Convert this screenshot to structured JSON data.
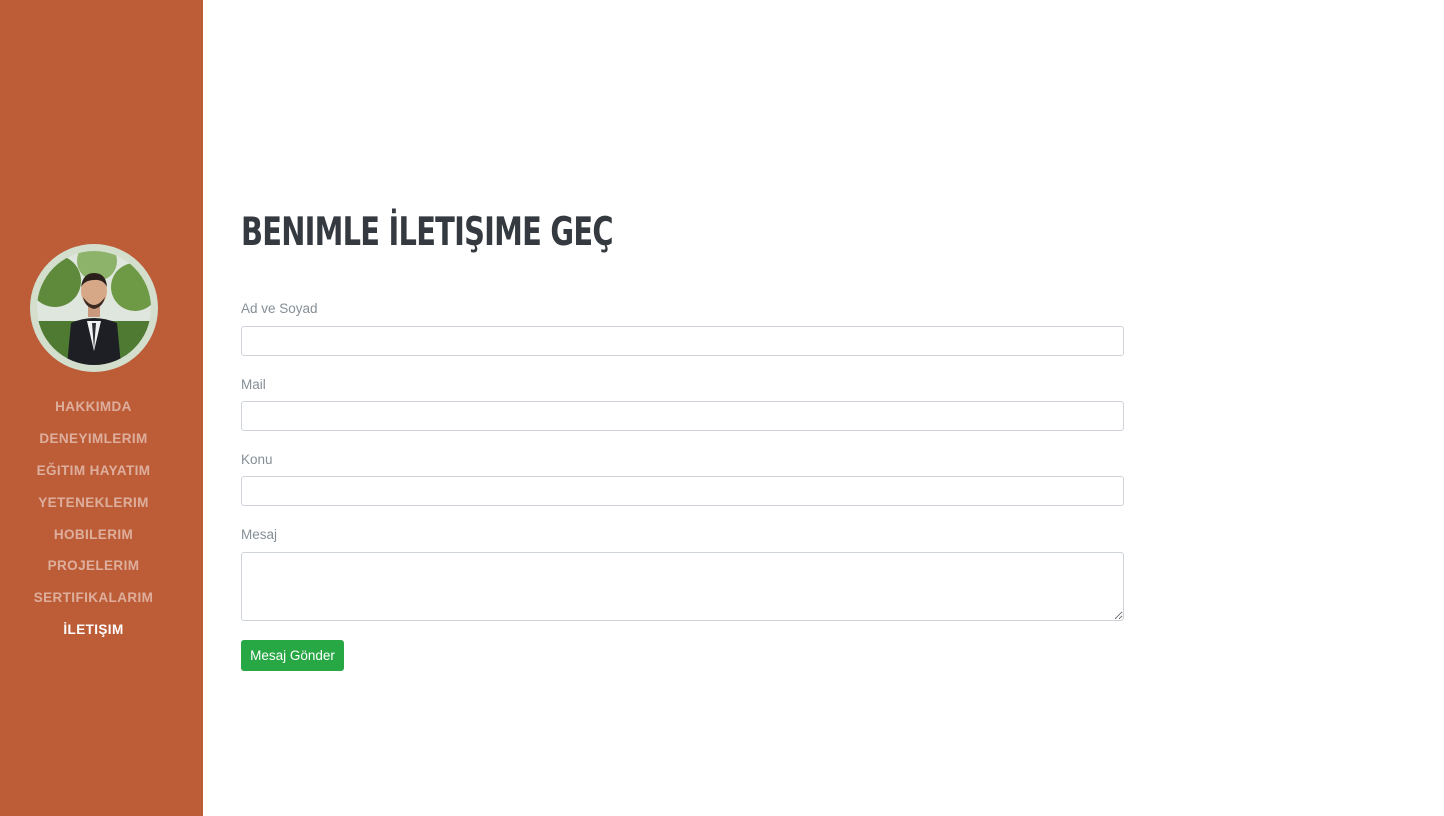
{
  "sidebar": {
    "bg_color": "#bd5d38",
    "avatar_alt": "profile photo",
    "items": [
      {
        "label": "Hakkımda"
      },
      {
        "label": "Deneyimlerim"
      },
      {
        "label": "Eğitim Hayatım"
      },
      {
        "label": "Yeteneklerim"
      },
      {
        "label": "Hobilerim"
      },
      {
        "label": "Projelerim"
      },
      {
        "label": "Sertifikalarım"
      },
      {
        "label": "İletişim"
      }
    ],
    "active_index": 7
  },
  "main": {
    "title": "Benimle İletişime Geç",
    "form": {
      "name_label": "Ad ve Soyad",
      "name_value": "",
      "mail_label": "Mail",
      "mail_value": "",
      "subject_label": "Konu",
      "subject_value": "",
      "message_label": "Mesaj",
      "message_value": "",
      "submit_label": "Mesaj Gönder"
    }
  },
  "colors": {
    "accent": "#bd5d38",
    "submit": "#28a745",
    "title": "#343a40",
    "label": "#868e96"
  }
}
